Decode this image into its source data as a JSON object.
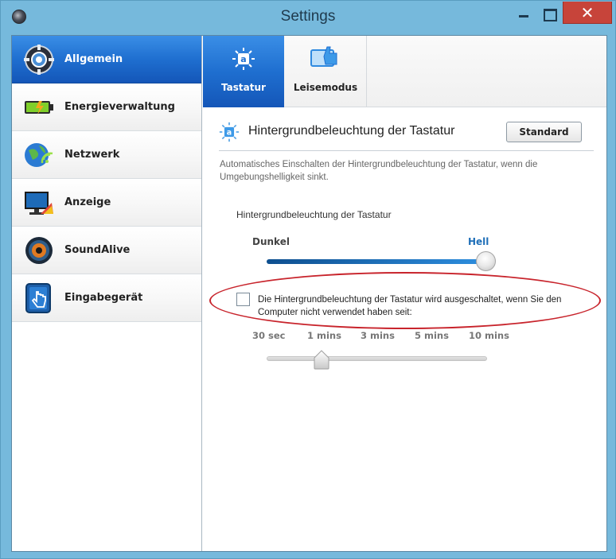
{
  "window": {
    "title": "Settings",
    "close_glyph": "✕"
  },
  "sidebar": {
    "items": [
      {
        "label": "Allgemein",
        "icon": "gear-speaker-icon",
        "active": true
      },
      {
        "label": "Energieverwaltung",
        "icon": "battery-icon",
        "active": false
      },
      {
        "label": "Netzwerk",
        "icon": "globe-wifi-icon",
        "active": false
      },
      {
        "label": "Anzeige",
        "icon": "monitor-icon",
        "active": false
      },
      {
        "label": "SoundAlive",
        "icon": "speaker-icon",
        "active": false
      },
      {
        "label": "Eingabegerät",
        "icon": "touch-hand-icon",
        "active": false
      }
    ]
  },
  "tabs": [
    {
      "label": "Tastatur",
      "icon": "keyboard-backlight-icon",
      "active": true
    },
    {
      "label": "Leisemodus",
      "icon": "silent-mode-icon",
      "active": false
    }
  ],
  "section": {
    "title": "Hintergrundbeleuchtung der Tastatur",
    "standard_button": "Standard",
    "description": "Automatisches Einschalten der Hintergrundbeleuchtung der Tastatur, wenn die Umgebungshelligkeit sinkt."
  },
  "brightness_slider": {
    "title": "Hintergrundbeleuchtung der Tastatur",
    "min_label": "Dunkel",
    "max_label": "Hell",
    "value_fraction": 1.0
  },
  "timeout": {
    "checkbox_label": "Die Hintergrundbeleuchtung der Tastatur wird ausgeschaltet, wenn Sie den Computer nicht verwendet haben seit:",
    "checked": false,
    "ticks": [
      "30 sec",
      "1 mins",
      "3 mins",
      "5 mins",
      "10 mins"
    ],
    "selected_index": 1
  },
  "colors": {
    "accent": "#1f6fd0",
    "annotation": "#c8242c"
  }
}
